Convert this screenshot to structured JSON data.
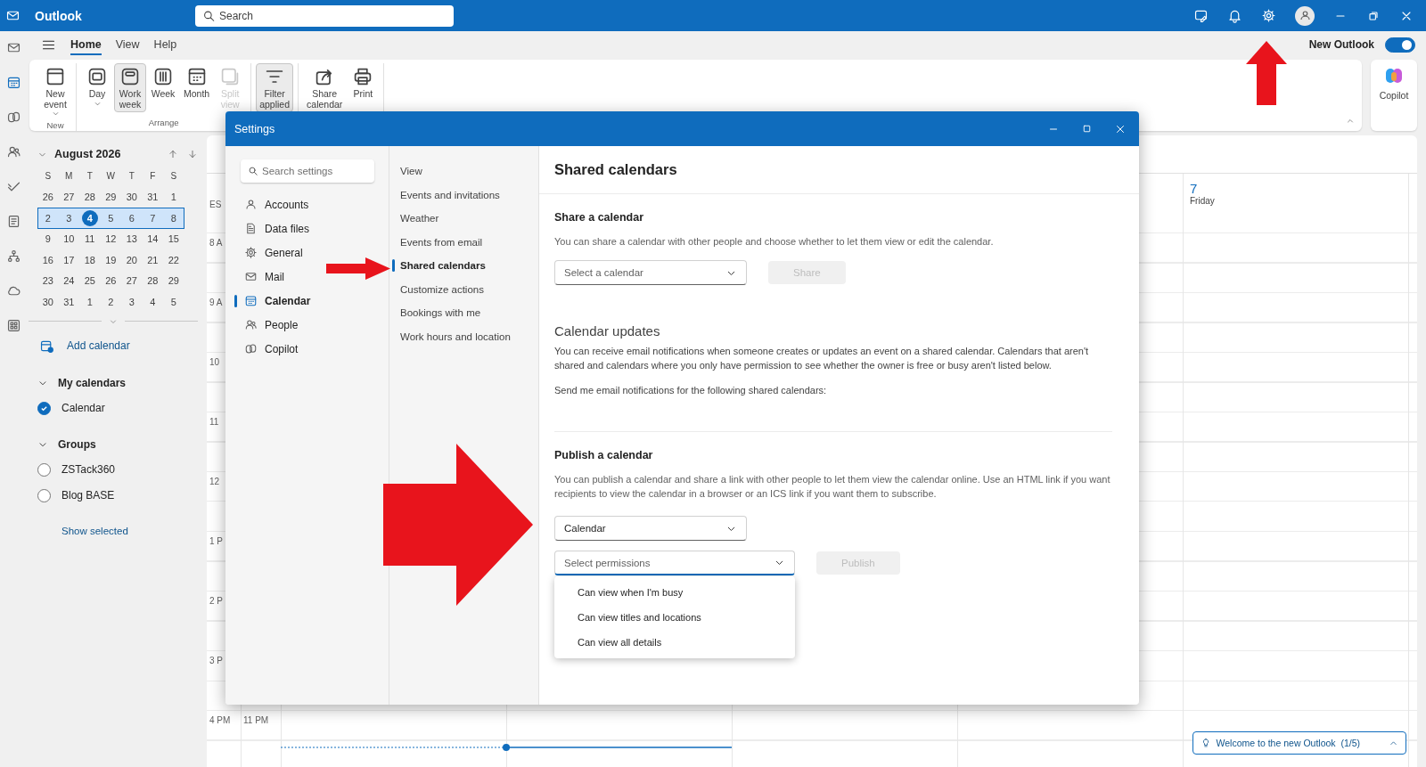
{
  "app_bar": {
    "title": "Outlook",
    "search": {
      "placeholder": "Search"
    }
  },
  "rail": [
    {
      "selected": false
    },
    {
      "selected": true
    },
    {
      "selected": false
    },
    {
      "selected": false
    },
    {
      "selected": false
    },
    {
      "selected": false
    },
    {
      "selected": false
    },
    {
      "selected": false
    },
    {
      "selected": false
    }
  ],
  "ribbon": {
    "tabs": [
      {
        "label": "Home",
        "selected": true
      },
      {
        "label": "View",
        "selected": false
      },
      {
        "label": "Help",
        "selected": false
      }
    ],
    "new_outlook": {
      "label": "New Outlook",
      "on": true
    },
    "groups": [
      {
        "label": "New",
        "buttons": [
          {
            "label": "New event",
            "dropdown": true,
            "selected": false,
            "disabled": false
          }
        ]
      },
      {
        "label": "Arrange",
        "buttons": [
          {
            "label": "Day",
            "dropdown": true,
            "selected": false,
            "disabled": false
          },
          {
            "label": "Work week",
            "dropdown": false,
            "selected": true,
            "disabled": false
          },
          {
            "label": "Week",
            "dropdown": false,
            "selected": false,
            "disabled": false
          },
          {
            "label": "Month",
            "dropdown": false,
            "selected": false,
            "disabled": false
          },
          {
            "label": "Split view",
            "dropdown": false,
            "selected": false,
            "disabled": true
          }
        ]
      },
      {
        "buttons": [
          {
            "label": "Filter applied",
            "dropdown": false,
            "selected": true,
            "disabled": false
          }
        ]
      },
      {
        "buttons": [
          {
            "label": "Share calendar",
            "dropdown": false,
            "selected": false,
            "disabled": false
          },
          {
            "label": "Print",
            "dropdown": false,
            "selected": false,
            "disabled": false
          }
        ]
      }
    ],
    "copilot": "Copilot"
  },
  "mini_calendar": {
    "month": "August 2026",
    "weekdays": [
      "S",
      "M",
      "T",
      "W",
      "T",
      "F",
      "S"
    ],
    "weeks": [
      {
        "selected": false,
        "days": [
          {
            "label": "26",
            "today": false
          },
          {
            "label": "27",
            "today": false
          },
          {
            "label": "28",
            "today": false
          },
          {
            "label": "29",
            "today": false
          },
          {
            "label": "30",
            "today": false
          },
          {
            "label": "31",
            "today": false
          },
          {
            "label": "1",
            "today": false
          }
        ]
      },
      {
        "selected": true,
        "days": [
          {
            "label": "2",
            "today": false
          },
          {
            "label": "3",
            "today": false
          },
          {
            "label": "4",
            "today": true
          },
          {
            "label": "5",
            "today": false
          },
          {
            "label": "6",
            "today": false
          },
          {
            "label": "7",
            "today": false
          },
          {
            "label": "8",
            "today": false
          }
        ]
      },
      {
        "selected": false,
        "days": [
          {
            "label": "9",
            "today": false
          },
          {
            "label": "10",
            "today": false
          },
          {
            "label": "11",
            "today": false
          },
          {
            "label": "12",
            "today": false
          },
          {
            "label": "13",
            "today": false
          },
          {
            "label": "14",
            "today": false
          },
          {
            "label": "15",
            "today": false
          }
        ]
      },
      {
        "selected": false,
        "days": [
          {
            "label": "16",
            "today": false
          },
          {
            "label": "17",
            "today": false
          },
          {
            "label": "18",
            "today": false
          },
          {
            "label": "19",
            "today": false
          },
          {
            "label": "20",
            "today": false
          },
          {
            "label": "21",
            "today": false
          },
          {
            "label": "22",
            "today": false
          }
        ]
      },
      {
        "selected": false,
        "days": [
          {
            "label": "23",
            "today": false
          },
          {
            "label": "24",
            "today": false
          },
          {
            "label": "25",
            "today": false
          },
          {
            "label": "26",
            "today": false
          },
          {
            "label": "27",
            "today": false
          },
          {
            "label": "28",
            "today": false
          },
          {
            "label": "29",
            "today": false
          }
        ]
      },
      {
        "selected": false,
        "days": [
          {
            "label": "30",
            "today": false
          },
          {
            "label": "31",
            "today": false
          },
          {
            "label": "1",
            "today": false
          },
          {
            "label": "2",
            "today": false
          },
          {
            "label": "3",
            "today": false
          },
          {
            "label": "4",
            "today": false
          },
          {
            "label": "5",
            "today": false
          }
        ]
      }
    ]
  },
  "calendars": {
    "add_calendar": "Add calendar",
    "sections": [
      {
        "label": "My calendars",
        "expanded": true,
        "items": [
          {
            "label": "Calendar",
            "checked": true
          }
        ]
      },
      {
        "label": "Groups",
        "expanded": true,
        "items": [
          {
            "label": "ZSTack360",
            "checked": false
          },
          {
            "label": "Blog BASE",
            "checked": false
          }
        ]
      }
    ],
    "show_selected": "Show selected"
  },
  "calendar_view": {
    "zone_label": "ES",
    "day_header": {
      "number": "7",
      "weekday": "Friday"
    },
    "time_rows": [
      {
        "primary": "8 A"
      },
      {
        "primary": "9 A"
      },
      {
        "primary": "10"
      },
      {
        "primary": "11"
      },
      {
        "primary": "12"
      },
      {
        "primary": "1 P"
      },
      {
        "primary": "2 P"
      },
      {
        "primary": "3 P"
      },
      {
        "primary": "4 PM",
        "secondary": "11 PM"
      }
    ],
    "tip": "Welcome to the new Outlook  (1/5)"
  },
  "settings": {
    "title": "Settings",
    "search": {
      "placeholder": "Search settings"
    },
    "nav": [
      {
        "label": "Accounts",
        "selected": false
      },
      {
        "label": "Data files",
        "selected": false
      },
      {
        "label": "General",
        "selected": false
      },
      {
        "label": "Mail",
        "selected": false
      },
      {
        "label": "Calendar",
        "selected": true
      },
      {
        "label": "People",
        "selected": false
      },
      {
        "label": "Copilot",
        "selected": false
      }
    ],
    "subnav": [
      {
        "label": "View",
        "selected": false
      },
      {
        "label": "Events and invitations",
        "selected": false
      },
      {
        "label": "Weather",
        "selected": false
      },
      {
        "label": "Events from email",
        "selected": false
      },
      {
        "label": "Shared calendars",
        "selected": true
      },
      {
        "label": "Customize actions",
        "selected": false
      },
      {
        "label": "Bookings with me",
        "selected": false
      },
      {
        "label": "Work hours and location",
        "selected": false
      }
    ],
    "page": {
      "title": "Shared calendars",
      "share": {
        "heading": "Share a calendar",
        "text": "You can share a calendar with other people and choose whether to let them view or edit the calendar.",
        "select": {
          "prompt": "Select a calendar"
        },
        "button": {
          "label": "Share",
          "disabled": true
        }
      },
      "updates": {
        "heading": "Calendar updates",
        "text": "You can receive email notifications when someone creates or updates an event on a shared calendar. Calendars that aren't shared and calendars where you only have permission to see whether the owner is free or busy aren't listed below.",
        "note": "Send me email notifications for the following shared calendars:"
      },
      "publish": {
        "heading": "Publish a calendar",
        "text": "You can publish a calendar and share a link with other people to let them view the calendar online. Use an HTML link if you want recipients to view the calendar in a browser or an ICS link if you want them to subscribe.",
        "calendar_select": {
          "value": "Calendar"
        },
        "permission_select": {
          "prompt": "Select permissions",
          "expanded": true,
          "options": [
            "Can view when I'm busy",
            "Can view titles and locations",
            "Can view all details"
          ]
        },
        "button": {
          "label": "Publish",
          "disabled": true
        }
      }
    }
  }
}
